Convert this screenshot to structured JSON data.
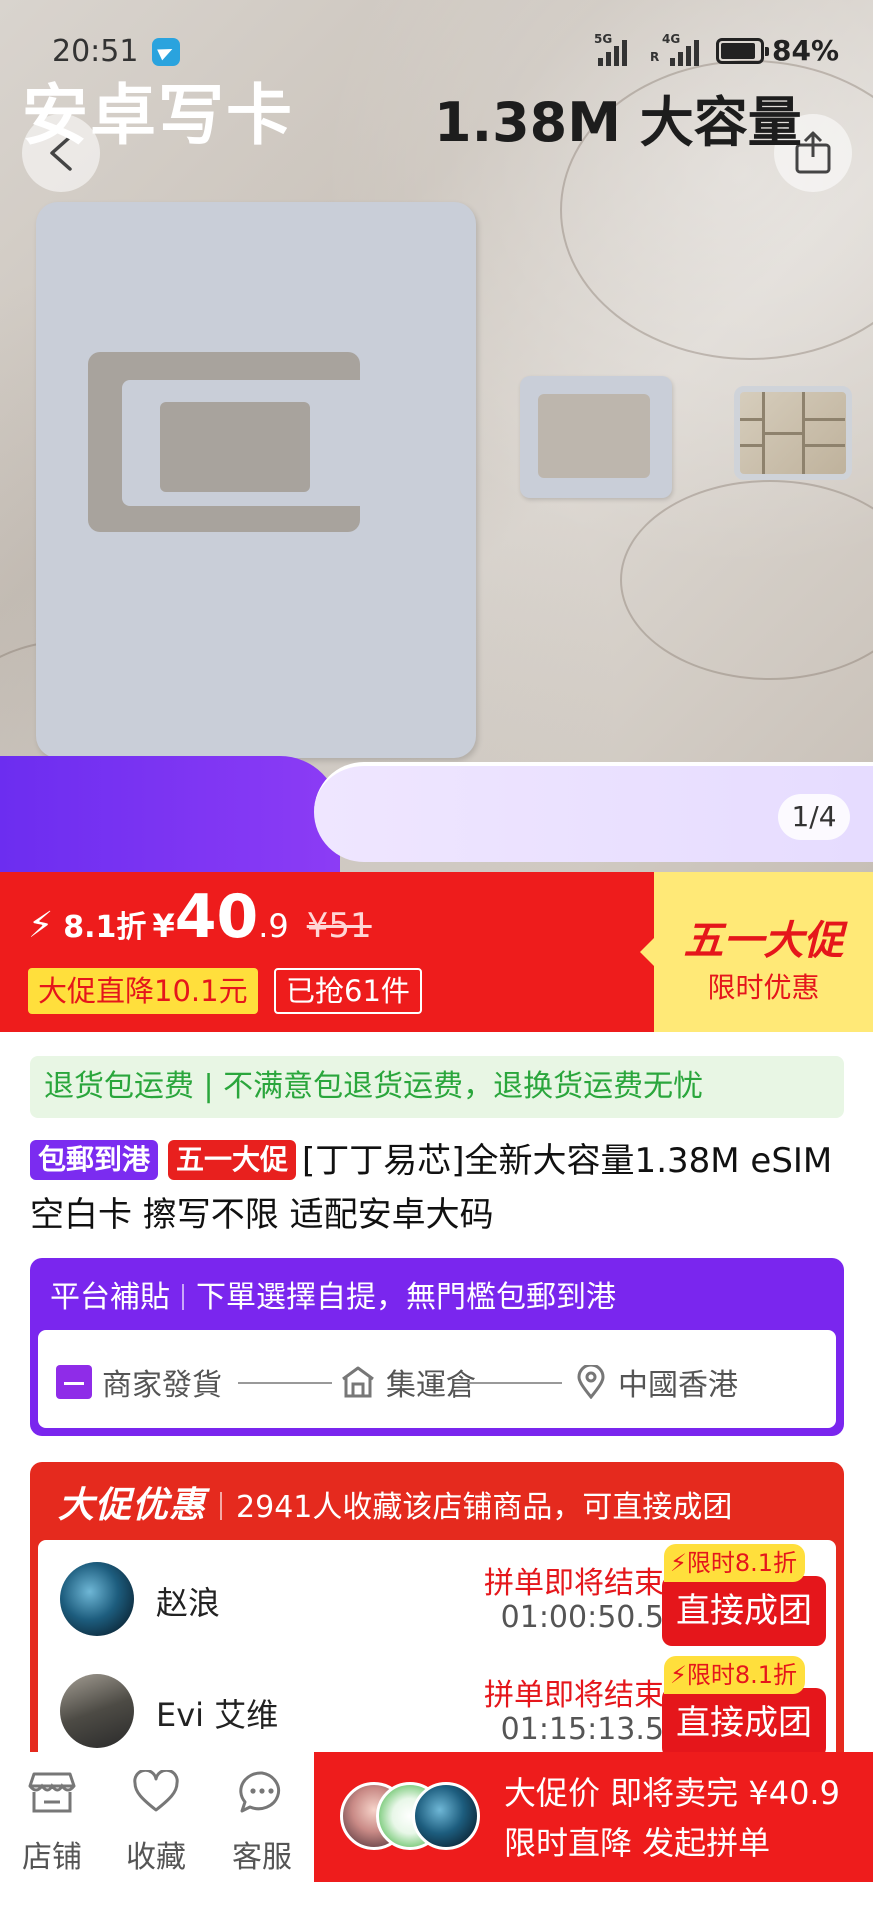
{
  "status_bar": {
    "time": "20:51",
    "net1": "5G",
    "net2": "4G",
    "net2_sub": "R",
    "battery": "84%",
    "battery_level": 0.84
  },
  "gallery": {
    "banner_left": "安卓写卡",
    "banner_right": "1.38M 大容量",
    "pager": "1/4"
  },
  "price": {
    "bolt": "⚡",
    "discount": "8.1折",
    "currency": "¥",
    "integer": "40",
    "decimal": ".9",
    "original": "¥51",
    "tag_drop": "大促直降10.1元",
    "tag_sold": "已抢61件",
    "promo_title": "五一大促",
    "promo_sub": "限时优惠"
  },
  "returns_bar": "退货包运费 | 不满意包退货运费，退换货运费无忧",
  "product": {
    "badge_shipping": "包郵到港",
    "badge_promo": "五一大促",
    "title": "[丁丁易芯]全新大容量1.38M eSIM 空白卡 擦写不限 适配安卓大码"
  },
  "subsidy": {
    "label": "平台補貼",
    "text": "下單選擇自提，無門檻包郵到港",
    "route": [
      "商家發貨",
      "集運倉",
      "中國香港"
    ]
  },
  "deal": {
    "label": "大促优惠",
    "text": "2941人收藏该店铺商品，可直接成团",
    "rows": [
      {
        "name": "赵浪",
        "status": "拼单即将结束",
        "timer": "01:00:50.5",
        "tag": "限时8.1折",
        "button": "直接成团"
      },
      {
        "name": "Evi 艾维",
        "status": "拼单即将结束",
        "timer": "01:15:13.5",
        "tag": "限时8.1折",
        "button": "直接成团"
      }
    ]
  },
  "bottom_bar": {
    "tabs": [
      "店铺",
      "收藏",
      "客服"
    ],
    "cta_line1": "大促价  即将卖完 ¥40.9",
    "cta_line2": "限时直降 发起拼单"
  },
  "colors": {
    "brand_red": "#ee1c1c",
    "promo_purple": "#7a26ee",
    "promo_yellow": "#ffe977",
    "return_green": "#2aa63c"
  }
}
